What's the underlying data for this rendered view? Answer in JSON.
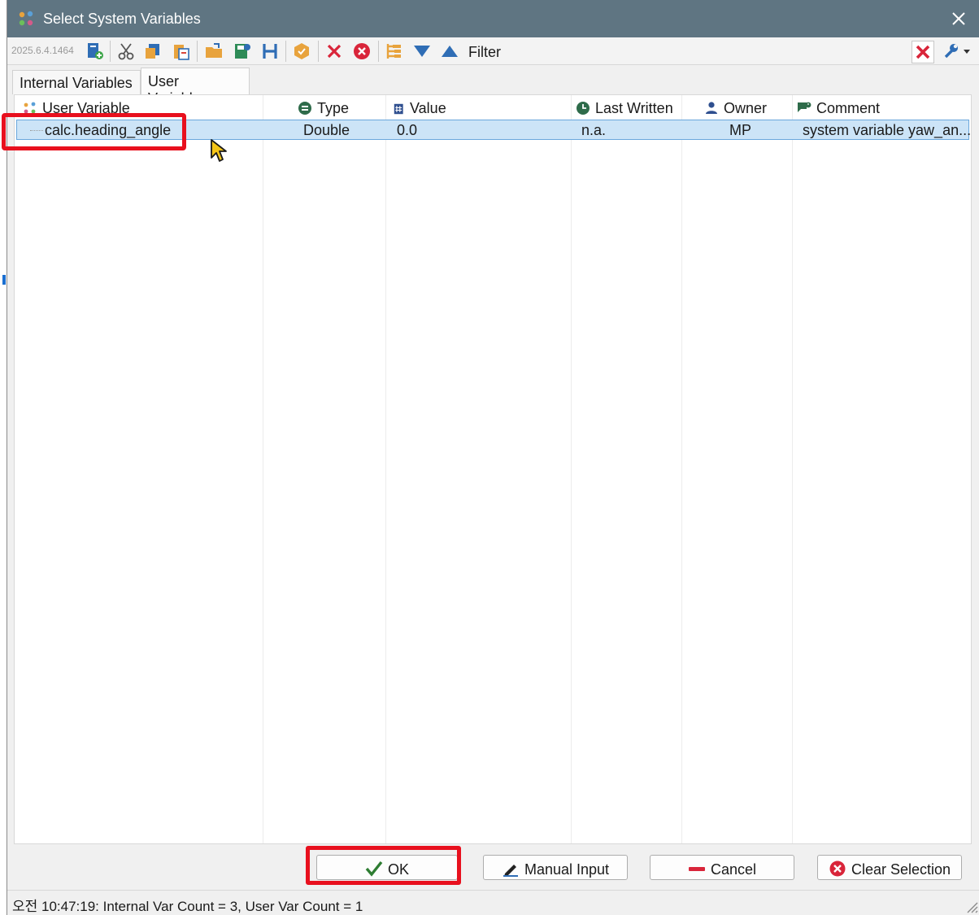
{
  "window": {
    "title": "Select System Variables"
  },
  "toolbar": {
    "version": "2025.6.4.1464",
    "filter_label": "Filter"
  },
  "tabs": [
    {
      "label": "Internal Variables",
      "active": false
    },
    {
      "label": "User Variables",
      "active": true
    }
  ],
  "table": {
    "columns": {
      "user_variable": "User Variable",
      "type": "Type",
      "value": "Value",
      "last_written": "Last Written",
      "owner": "Owner",
      "comment": "Comment"
    },
    "rows": [
      {
        "name": "calc.heading_angle",
        "type": "Double",
        "value": "0.0",
        "last_written": "n.a.",
        "owner": "MP",
        "comment": "system variable yaw_an..."
      }
    ]
  },
  "buttons": {
    "ok": "OK",
    "manual_input": "Manual Input",
    "cancel": "Cancel",
    "clear_selection": "Clear Selection"
  },
  "status": {
    "text": "오전 10:47:19: Internal Var Count = 3, User Var Count = 1"
  },
  "colors": {
    "titlebar": "#5f7582",
    "selection": "#cce4f7",
    "annotation": "#e8101e",
    "accent_blue": "#2f6db5",
    "ok_green": "#2e7d32"
  }
}
